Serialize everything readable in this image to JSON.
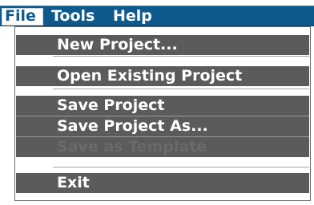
{
  "menubar": {
    "items": [
      {
        "label": "File"
      },
      {
        "label": "Tools"
      },
      {
        "label": "Help"
      }
    ]
  },
  "file_menu": {
    "items": [
      {
        "label": "New Project..."
      },
      {
        "label": "Open Existing Project"
      },
      {
        "label": "Save Project"
      },
      {
        "label": "Save Project As..."
      },
      {
        "label": "Save as Template",
        "enabled": false
      },
      {
        "label": "Exit"
      }
    ]
  },
  "colors": {
    "menubar_bg": "#0f5a8c",
    "menu_item_bg": "#5b5b5b",
    "menu_text": "#ffffff",
    "disabled_text": "#6a6a6a"
  }
}
